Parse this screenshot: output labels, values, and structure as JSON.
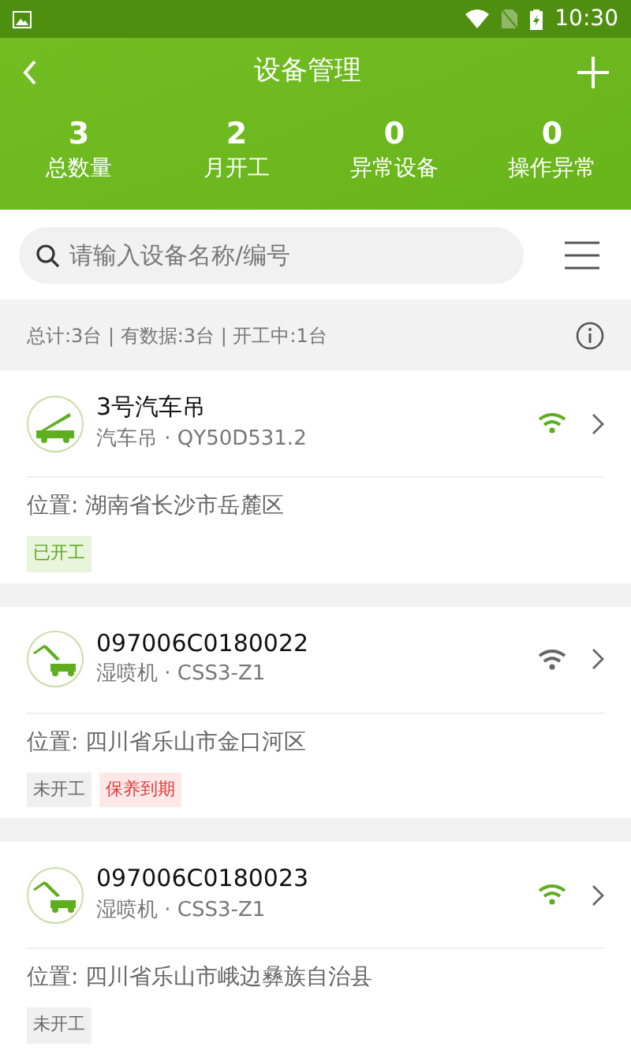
{
  "status_bar": {
    "time": "10:30"
  },
  "header": {
    "title": "设备管理"
  },
  "stats": [
    {
      "value": "3",
      "label": "总数量"
    },
    {
      "value": "2",
      "label": "月开工"
    },
    {
      "value": "0",
      "label": "异常设备"
    },
    {
      "value": "0",
      "label": "操作异常"
    }
  ],
  "search": {
    "placeholder": "请输入设备名称/编号"
  },
  "summary": "总计:3台 | 有数据:3台 | 开工中:1台",
  "devices": [
    {
      "kind": "crane",
      "name": "3号汽车吊",
      "subtitle": "汽车吊 · QY50D531.2",
      "online": true,
      "location": "位置: 湖南省长沙市岳麓区",
      "tags": [
        {
          "kind": "working",
          "text": "已开工"
        }
      ]
    },
    {
      "kind": "sprayer",
      "name": "097006C0180022",
      "subtitle": "湿喷机 · CSS3-Z1",
      "online": false,
      "location": "位置: 四川省乐山市金口河区",
      "tags": [
        {
          "kind": "idle",
          "text": "未开工"
        },
        {
          "kind": "alert",
          "text": "保养到期"
        }
      ]
    },
    {
      "kind": "sprayer",
      "name": "097006C0180023",
      "subtitle": "湿喷机 · CSS3-Z1",
      "online": true,
      "location": "位置: 四川省乐山市峨边彝族自治县",
      "tags": [
        {
          "kind": "idle",
          "text": "未开工"
        }
      ]
    }
  ]
}
